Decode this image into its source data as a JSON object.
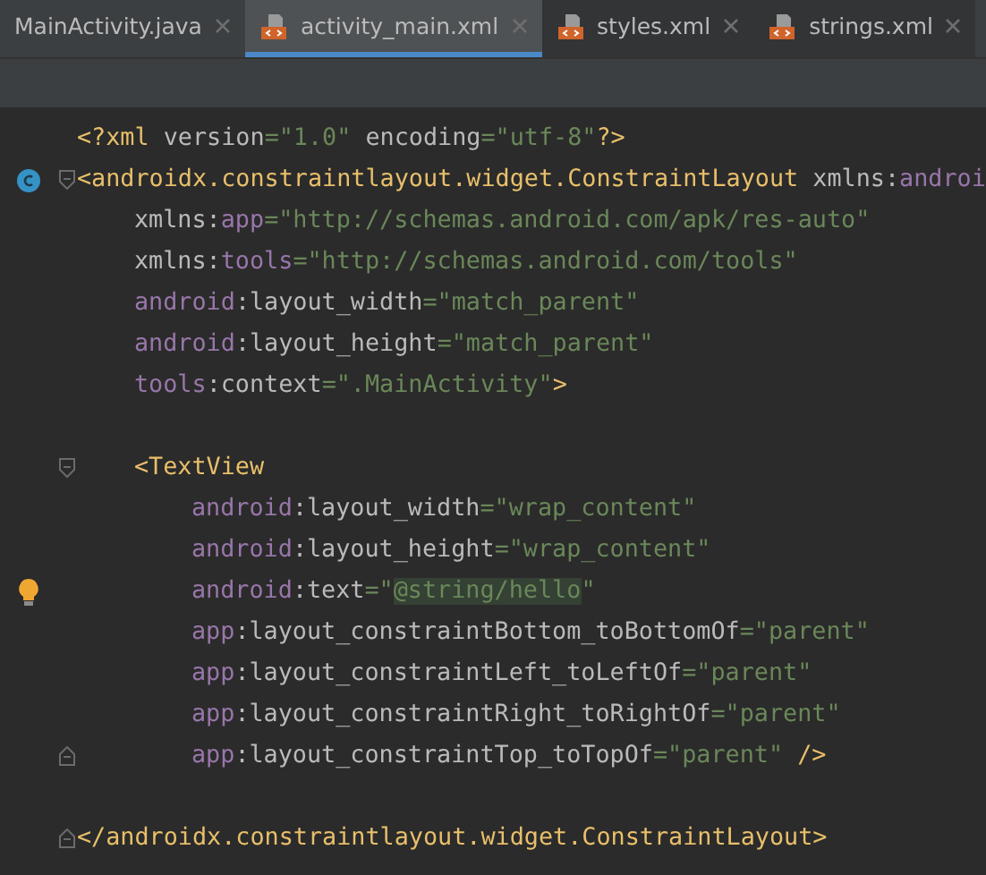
{
  "tabs": [
    {
      "label": "MainActivity.java",
      "kind": "java",
      "selected": false
    },
    {
      "label": "activity_main.xml",
      "kind": "xml",
      "selected": true
    },
    {
      "label": "styles.xml",
      "kind": "xml",
      "selected": false
    },
    {
      "label": "strings.xml",
      "kind": "xml",
      "selected": false
    }
  ],
  "code_lines": [
    {
      "kind": "code",
      "tokens": [
        {
          "kind": "tag",
          "text": "<?xml "
        },
        {
          "kind": "plain",
          "text": "version"
        },
        {
          "kind": "value",
          "text": "=\"1.0\" "
        },
        {
          "kind": "plain",
          "text": "encoding"
        },
        {
          "kind": "value",
          "text": "=\"utf-8\""
        },
        {
          "kind": "tag",
          "text": "?>"
        }
      ]
    },
    {
      "kind": "class_gutter",
      "tokens": [
        {
          "kind": "tag",
          "text": "<androidx.constraintlayout.widget.ConstraintLayout "
        },
        {
          "kind": "plain",
          "text": "xmlns:"
        },
        {
          "kind": "ns",
          "text": "androi"
        }
      ],
      "children": [
        {
          "kind": "code",
          "tokens": [
            {
              "kind": "plain",
              "text": "xmlns:"
            },
            {
              "kind": "ns",
              "text": "app"
            },
            {
              "kind": "value",
              "text": "=\"http://schemas.android.com/apk/res-auto\""
            }
          ]
        },
        {
          "kind": "code",
          "tokens": [
            {
              "kind": "plain",
              "text": "xmlns:"
            },
            {
              "kind": "ns",
              "text": "tools"
            },
            {
              "kind": "value",
              "text": "=\"http://schemas.android.com/tools\""
            }
          ]
        },
        {
          "kind": "code",
          "tokens": [
            {
              "kind": "ns",
              "text": "android"
            },
            {
              "kind": "plain",
              "text": ":layout_width"
            },
            {
              "kind": "value",
              "text": "=\"match_parent\""
            }
          ]
        },
        {
          "kind": "code",
          "tokens": [
            {
              "kind": "ns",
              "text": "android"
            },
            {
              "kind": "plain",
              "text": ":layout_height"
            },
            {
              "kind": "value",
              "text": "=\"match_parent\""
            }
          ]
        },
        {
          "kind": "code",
          "tokens": [
            {
              "kind": "ns",
              "text": "tools"
            },
            {
              "kind": "plain",
              "text": ":context"
            },
            {
              "kind": "value",
              "text": "=\".MainActivity\""
            },
            {
              "kind": "tag",
              "text": ">"
            }
          ]
        },
        {
          "kind": "blank"
        },
        {
          "kind": "code",
          "tokens": [
            {
              "kind": "tag",
              "text": "<TextView"
            }
          ],
          "children": [
            {
              "kind": "code",
              "tokens": [
                {
                  "kind": "ns",
                  "text": "android"
                },
                {
                  "kind": "plain",
                  "text": ":layout_width"
                },
                {
                  "kind": "value",
                  "text": "=\"wrap_content\""
                }
              ]
            },
            {
              "kind": "code",
              "tokens": [
                {
                  "kind": "ns",
                  "text": "android"
                },
                {
                  "kind": "plain",
                  "text": ":layout_height"
                },
                {
                  "kind": "value",
                  "text": "=\"wrap_content\""
                }
              ]
            },
            {
              "kind": "bulb_gutter",
              "tokens": [
                {
                  "kind": "ns",
                  "text": "android"
                },
                {
                  "kind": "plain",
                  "text": ":text"
                },
                {
                  "kind": "value",
                  "text": "=\""
                },
                {
                  "kind": "highlight",
                  "text": "@string/hello"
                },
                {
                  "kind": "value",
                  "text": "\""
                }
              ]
            },
            {
              "kind": "code",
              "tokens": [
                {
                  "kind": "ns",
                  "text": "app"
                },
                {
                  "kind": "plain",
                  "text": ":layout_constraintBottom_toBottomOf"
                },
                {
                  "kind": "value",
                  "text": "=\"parent\""
                }
              ]
            },
            {
              "kind": "code",
              "tokens": [
                {
                  "kind": "ns",
                  "text": "app"
                },
                {
                  "kind": "plain",
                  "text": ":layout_constraintLeft_toLeftOf"
                },
                {
                  "kind": "value",
                  "text": "=\"parent\""
                }
              ]
            },
            {
              "kind": "code",
              "tokens": [
                {
                  "kind": "ns",
                  "text": "app"
                },
                {
                  "kind": "plain",
                  "text": ":layout_constraintRight_toRightOf"
                },
                {
                  "kind": "value",
                  "text": "=\"parent\""
                }
              ]
            },
            {
              "kind": "code",
              "tokens": [
                {
                  "kind": "ns",
                  "text": "app"
                },
                {
                  "kind": "plain",
                  "text": ":layout_constraintTop_toTopOf"
                },
                {
                  "kind": "value",
                  "text": "=\"parent\" "
                },
                {
                  "kind": "tag",
                  "text": "/>"
                }
              ]
            }
          ]
        },
        {
          "kind": "blank"
        }
      ],
      "closing": {
        "tokens": [
          {
            "kind": "tag",
            "text": "</androidx.constraintlayout.widget.ConstraintLayout>"
          }
        ]
      }
    }
  ]
}
